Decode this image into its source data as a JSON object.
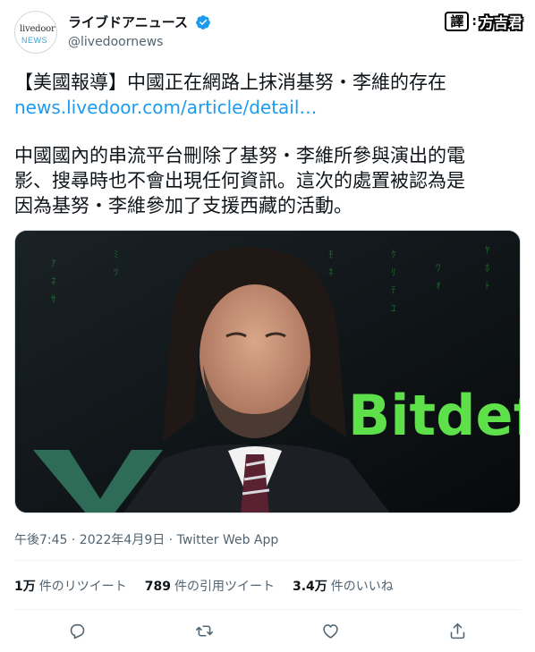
{
  "account": {
    "display_name": "ライブドアニュース",
    "handle": "@livedoornews",
    "avatar_line1": "livedoor",
    "avatar_line2": "NEWS",
    "verified": true
  },
  "credit": {
    "badge": "譯",
    "separator": ":",
    "translator": "方吉君"
  },
  "tweet": {
    "headline": "【美國報導】中國正在網路上抹消基努・李維的存在",
    "link": "news.livedoor.com/article/detail…",
    "body_lines": [
      "中國國內的串流平台刪除了基努・李維所參與演出的電",
      "影、搜尋時也不會出現任何資訊。這次的處置被認為是",
      "因為基努・李維參加了支援西藏的活動。"
    ],
    "image_text": "Bitdefe",
    "timestamp": "午後7:45 · 2022年4月9日 · Twitter Web App"
  },
  "stats": {
    "retweets": {
      "count": "1万",
      "label": "件のリツイート"
    },
    "quotes": {
      "count": "789",
      "label": "件の引用ツイート"
    },
    "likes": {
      "count": "3.4万",
      "label": "件のいいね"
    }
  },
  "actions": [
    "reply-icon",
    "retweet-icon",
    "like-icon",
    "share-icon"
  ],
  "colors": {
    "link": "#1d9bf0",
    "muted": "#536471",
    "verified": "#1d9bf0",
    "image_green": "#5ee04a"
  }
}
